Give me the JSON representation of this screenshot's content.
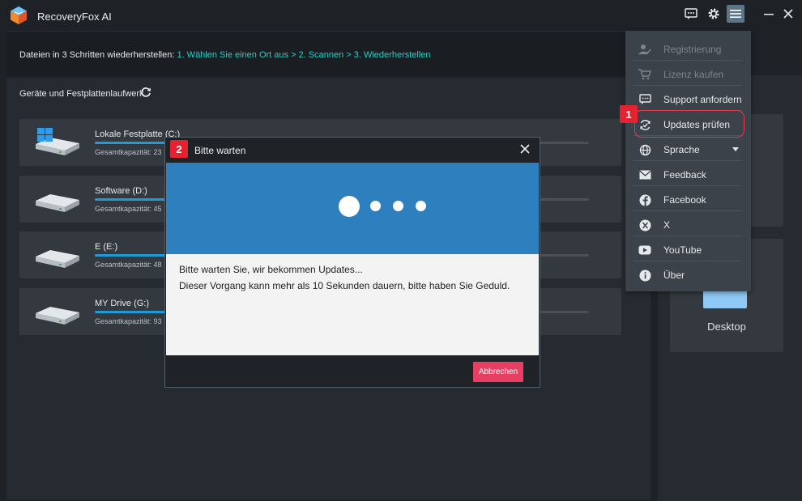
{
  "app": {
    "title": "RecoveryFox AI"
  },
  "steps": {
    "prefix": "Dateien in 3 Schritten wiederherstellen:",
    "link": "1. Wählen Sie einen Ort aus > 2. Scannen > 3. Wiederherstellen"
  },
  "devices": {
    "section_title": "Geräte und Festplattenlaufwerk",
    "drives": [
      {
        "name": "Lokale Festplatte (C:)",
        "capacity": "Gesamtkapazität: 23",
        "used_fraction": 0.2
      },
      {
        "name": "Software (D:)",
        "capacity": "Gesamtkapazität: 45",
        "used_fraction": 0.18
      },
      {
        "name": "E (E:)",
        "capacity": "Gesamtkapazität: 48",
        "used_fraction": 0.16
      },
      {
        "name": "MY Drive (G:)",
        "capacity": "Gesamtkapazität: 93",
        "used_fraction": 0.22
      }
    ]
  },
  "locations": {
    "desktop_label": "Desktop"
  },
  "menu": {
    "items": [
      {
        "label": "Registrierung",
        "icon": "user-check-icon",
        "disabled": true
      },
      {
        "label": "Lizenz kaufen",
        "icon": "cart-icon",
        "disabled": true
      },
      {
        "label": "Support anfordern",
        "icon": "chat-icon",
        "disabled": false
      },
      {
        "label": "Updates prüfen",
        "icon": "update-icon",
        "disabled": false
      },
      {
        "label": "Sprache",
        "icon": "globe-icon",
        "disabled": false
      },
      {
        "label": "Feedback",
        "icon": "mail-icon",
        "disabled": false
      },
      {
        "label": "Facebook",
        "icon": "facebook-icon",
        "disabled": false
      },
      {
        "label": "X",
        "icon": "x-logo-icon",
        "disabled": false
      },
      {
        "label": "YouTube",
        "icon": "youtube-icon",
        "disabled": false
      },
      {
        "label": "Über",
        "icon": "info-icon",
        "disabled": false
      }
    ]
  },
  "annotations": {
    "badge1": "1",
    "badge2": "2"
  },
  "dialog": {
    "title": "Bitte warten",
    "line1": "Bitte warten Sie, wir bekommen Updates...",
    "line2": "Dieser Vorgang kann mehr als 10 Sekunden dauern, bitte haben Sie Geduld.",
    "cancel_label": "Abbrechen"
  },
  "colors": {
    "accent": "#25d0c7",
    "progress": "#1e9bd8",
    "dialog_hero": "#2d7fbd",
    "cancel": "#e73f63",
    "annotation": "#e5222f"
  }
}
